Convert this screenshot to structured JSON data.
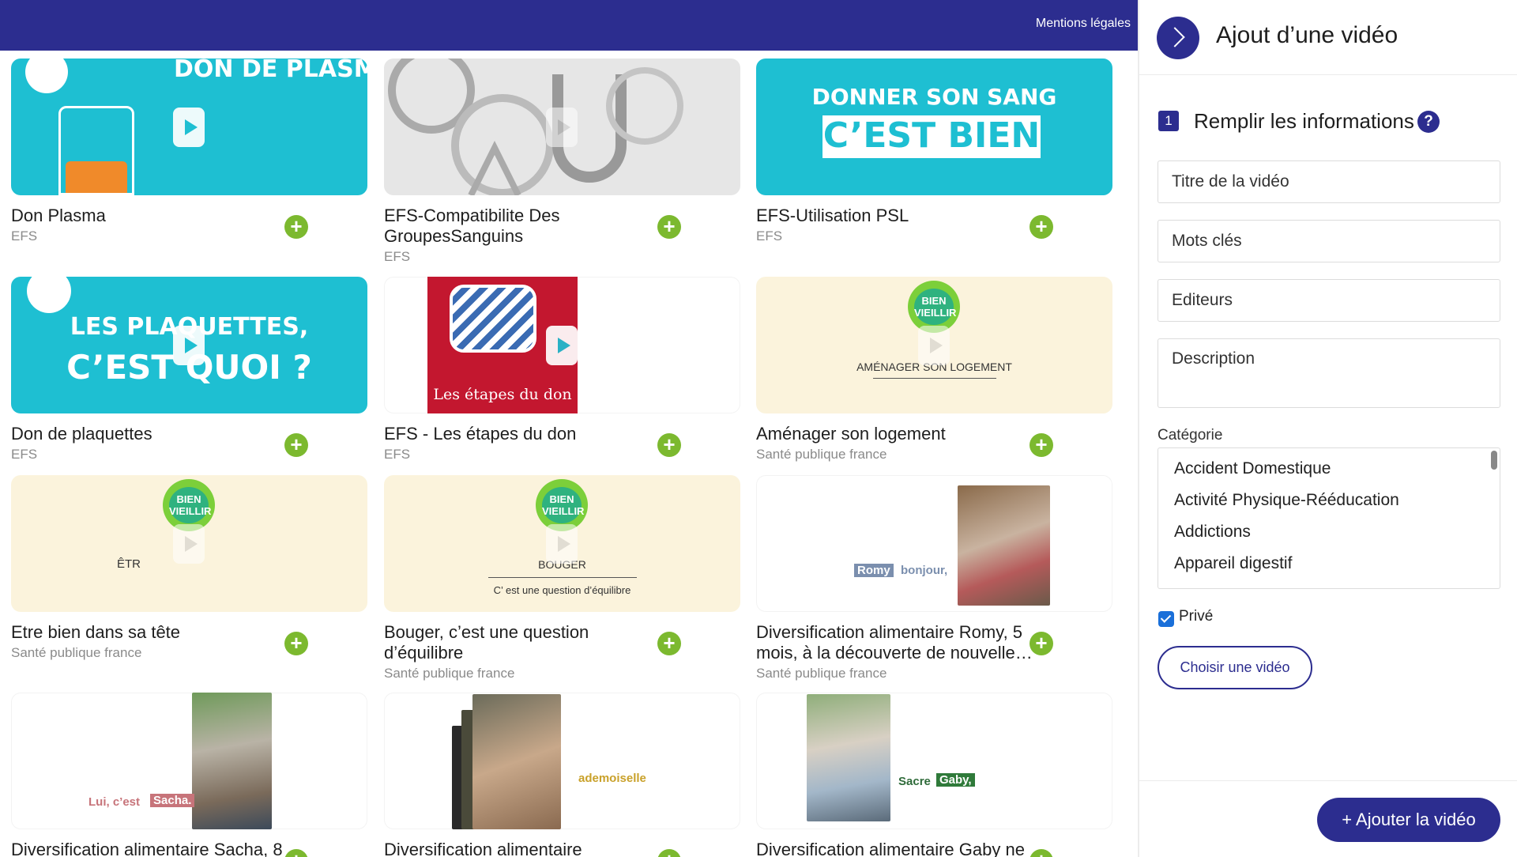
{
  "header": {
    "legal_link": "Mentions légales"
  },
  "videos": [
    {
      "title": "Don Plasma",
      "subtitle": "EFS",
      "thumb_text": "DON DE PLASMA"
    },
    {
      "title": "EFS-Compatibilite Des GroupesSanguins",
      "subtitle": "EFS"
    },
    {
      "title": "EFS-Utilisation PSL",
      "subtitle": "EFS",
      "thumb_line1": "DONNER SON SANG",
      "thumb_line2": "C’EST BIEN"
    },
    {
      "title": "Don de plaquettes",
      "subtitle": "EFS",
      "thumb_line1": "LES PLAQUETTES,",
      "thumb_line2": "C’EST QUOI ?"
    },
    {
      "title": "EFS - Les étapes du don",
      "subtitle": "EFS",
      "thumb_text": "Les étapes du don"
    },
    {
      "title": "Aménager son logement",
      "subtitle": "Santé publique france",
      "thumb_text": "AMÉNAGER SON LOGEMENT"
    },
    {
      "title": "Etre bien dans sa tête",
      "subtitle": "Santé publique france",
      "thumb_text": "ÊTR"
    },
    {
      "title": "Bouger, c’est une question d’équilibre",
      "subtitle": "Santé publique france",
      "thumb_line1": "BOUGER",
      "thumb_line2": "C’ est une question d’équilibre"
    },
    {
      "title": "Diversification alimentaire Romy, 5 mois, à la découverte de nouvelle…",
      "subtitle": "Santé publique france",
      "thumb_name": "Romy",
      "thumb_word": "bonjour,"
    },
    {
      "title": "Diversification alimentaire Sacha, 8",
      "subtitle": "",
      "thumb_prefix": "Lui, c’est",
      "thumb_name": "Sacha."
    },
    {
      "title": "Diversification alimentaire",
      "subtitle": "",
      "thumb_word": "ademoiselle"
    },
    {
      "title": "Diversification alimentaire Gaby ne",
      "subtitle": "",
      "thumb_prefix": "Sacre",
      "thumb_name": "Gaby,"
    }
  ],
  "badge_text": "BIEN VIEILLIR",
  "add_symbol": "+",
  "panel": {
    "title": "Ajout d’une vidéo",
    "step_number": "1",
    "step_title": "Remplir les informations",
    "help": "?",
    "fields": {
      "title_placeholder": "Titre de la vidéo",
      "keywords_placeholder": "Mots clés",
      "editors_placeholder": "Editeurs",
      "description_placeholder": "Description"
    },
    "category_label": "Catégorie",
    "categories": [
      "Accident Domestique",
      "Activité Physique-Rééducation",
      "Addictions",
      "Appareil digestif"
    ],
    "private_label": "Privé",
    "private_checked": true,
    "choose_button": "Choisir une vidéo",
    "submit_button": "+ Ajouter la vidéo"
  },
  "colors": {
    "brand": "#2c2d8f",
    "teal": "#1ebfd2",
    "add_green": "#7cb92f",
    "cream": "#fbf3dc"
  }
}
